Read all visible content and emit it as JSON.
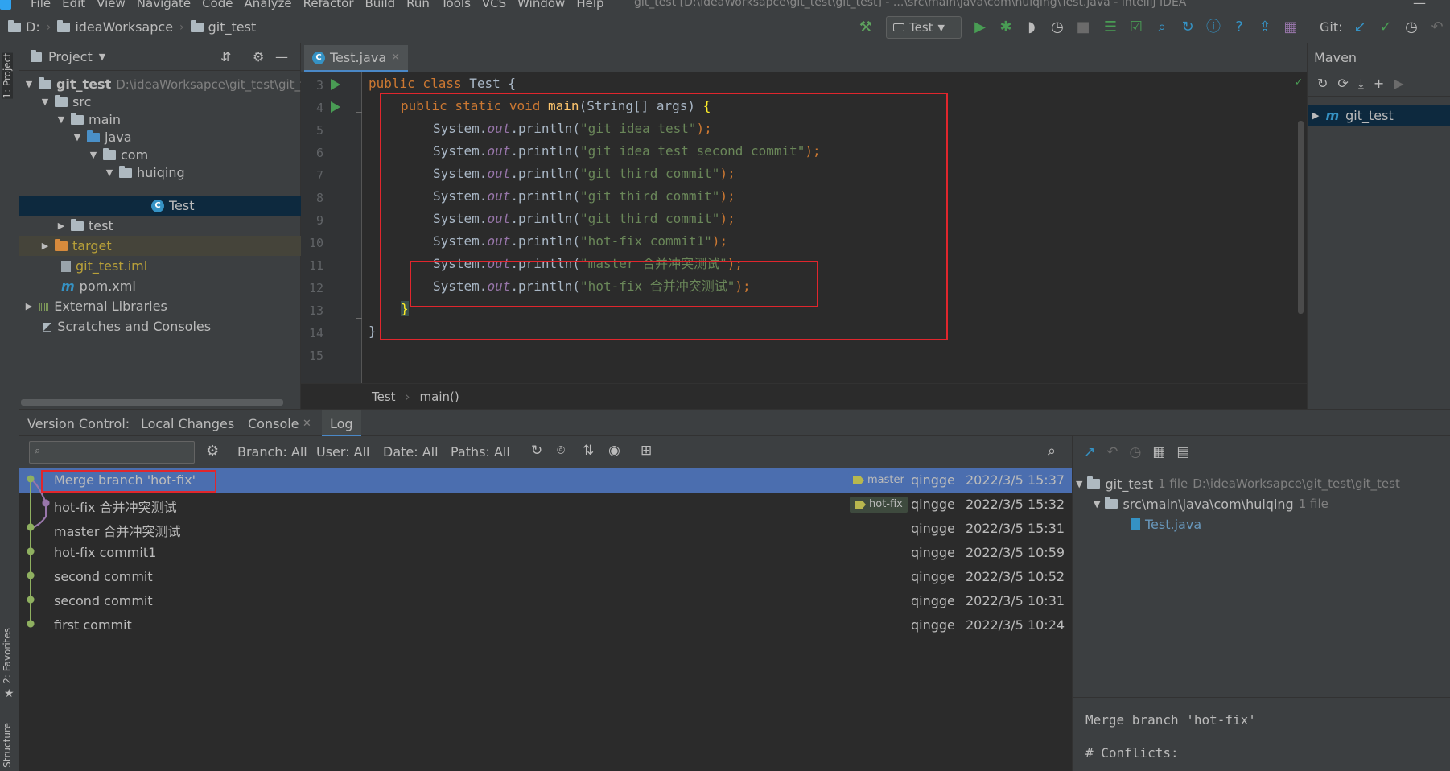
{
  "menubar": {
    "items": [
      "File",
      "Edit",
      "View",
      "Navigate",
      "Code",
      "Analyze",
      "Refactor",
      "Build",
      "Run",
      "Tools",
      "VCS",
      "Window",
      "Help"
    ],
    "title": "git_test [D:\\ideaWorksapce\\git_test\\git_test] - ...\\src\\main\\java\\com\\huiqing\\Test.java - IntelliJ IDEA"
  },
  "navbar": {
    "breadcrumbs": [
      "D:",
      "ideaWorksapce",
      "git_test"
    ],
    "run_config": "Test",
    "git_label": "Git:"
  },
  "left_strip": {
    "project_label": "1: Project",
    "favorites_label": "2: Favorites",
    "structure_label": "Structure"
  },
  "project": {
    "header": "Project",
    "tree": [
      {
        "label": "git_test",
        "extra": "D:\\ideaWorksapce\\git_test\\git_te",
        "icon": "folder-icon"
      },
      {
        "label": "src",
        "icon": "folder-icon"
      },
      {
        "label": "main",
        "icon": "folder-icon"
      },
      {
        "label": "java",
        "icon": "folder-blue-icon"
      },
      {
        "label": "com",
        "icon": "package-icon"
      },
      {
        "label": "huiqing",
        "icon": "package-icon"
      },
      {
        "label": "Test",
        "icon": "class-icon"
      },
      {
        "label": "test",
        "icon": "folder-icon"
      },
      {
        "label": "target",
        "icon": "folder-orange-icon"
      },
      {
        "label": "git_test.iml",
        "icon": "iml-file-icon"
      },
      {
        "label": "pom.xml",
        "icon": "maven-file-icon"
      },
      {
        "label": "External Libraries",
        "icon": "libraries-icon"
      },
      {
        "label": "Scratches and Consoles",
        "icon": "scratches-icon"
      }
    ]
  },
  "editor": {
    "tab": "Test.java",
    "line_numbers": [
      "3",
      "4",
      "5",
      "6",
      "7",
      "8",
      "9",
      "10",
      "11",
      "12",
      "13",
      "14",
      "15"
    ],
    "breadcrumbs": [
      "Test",
      "main()"
    ],
    "code": {
      "l3_kw": "public class ",
      "l3_name": "Test ",
      "l3_brace": "{",
      "l4_kw": "public static void ",
      "l4_fn": "main",
      "l4_args": "(String[] args) ",
      "l4_brace": "{",
      "sys": "System.",
      "out": "out",
      "println": ".println(",
      "close": ");",
      "s5": "\"git idea test\"",
      "s6": "\"git idea test second commit\"",
      "s7": "\"git third commit\"",
      "s8": "\"git third commit\"",
      "s9": "\"git third commit\"",
      "s10": "\"hot-fix commit1\"",
      "s11": "\"master 合并冲突测试\"",
      "s12": "\"hot-fix 合并冲突测试\"",
      "l13": "}",
      "l14": "}"
    }
  },
  "maven": {
    "header": "Maven",
    "item": "git_test"
  },
  "version_control": {
    "label": "Version Control:",
    "tabs": [
      "Local Changes",
      "Console",
      "Log"
    ],
    "filters": {
      "branch": "Branch: All",
      "user": "User: All",
      "date": "Date: All",
      "paths": "Paths: All"
    },
    "commits": [
      {
        "message": "Merge branch 'hot-fix'",
        "tag": "master",
        "author": "qingge",
        "date": "2022/3/5 15:37"
      },
      {
        "message": "hot-fix 合并冲突测试",
        "tag": "hot-fix",
        "author": "qingge",
        "date": "2022/3/5 15:32"
      },
      {
        "message": "master 合并冲突测试",
        "tag": "",
        "author": "qingge",
        "date": "2022/3/5 15:31"
      },
      {
        "message": "hot-fix commit1",
        "tag": "",
        "author": "qingge",
        "date": "2022/3/5 10:59"
      },
      {
        "message": "second commit",
        "tag": "",
        "author": "qingge",
        "date": "2022/3/5 10:52"
      },
      {
        "message": "second commit",
        "tag": "",
        "author": "qingge",
        "date": "2022/3/5 10:31"
      },
      {
        "message": "first commit",
        "tag": "",
        "author": "qingge",
        "date": "2022/3/5 10:24"
      }
    ]
  },
  "details": {
    "root": "git_test",
    "root_count": "1 file",
    "root_path": "D:\\ideaWorksapce\\git_test\\git_test",
    "dir": "src\\main\\java\\com\\huiqing",
    "dir_count": "1 file",
    "file": "Test.java",
    "message_title": "Merge branch 'hot-fix'",
    "message_conflicts": "# Conflicts:"
  },
  "colors": {
    "accent": "#4b6eaf",
    "highlight_box": "#e0262d",
    "graph": "#8fb060"
  }
}
